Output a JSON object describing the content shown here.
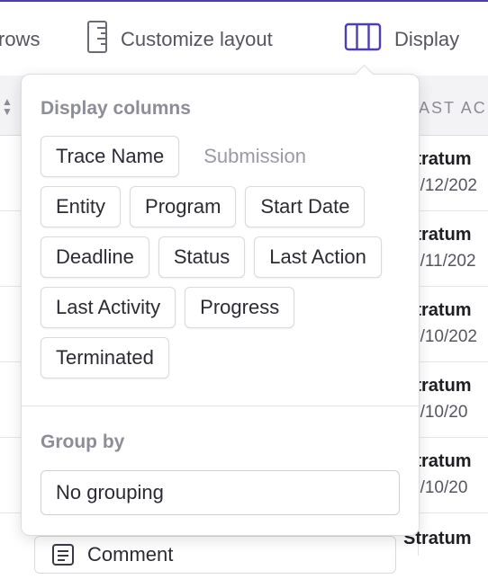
{
  "toolbar": {
    "rows_label": "rows",
    "layout_label": "Customize layout",
    "display_label": "Display"
  },
  "table": {
    "partial_header": "AST AC",
    "rows": [
      {
        "name": "Stratum",
        "date": "0/12/202"
      },
      {
        "name": "Stratum",
        "date": "2/11/202"
      },
      {
        "name": "Stratum",
        "date": "5/10/202"
      },
      {
        "name": "Stratum",
        "date": "4/10/20"
      },
      {
        "name": "Stratum",
        "date": "4/10/20"
      },
      {
        "name": "Stratum",
        "date": ""
      }
    ],
    "comment_label": "Comment"
  },
  "popover": {
    "display_columns_title": "Display columns",
    "columns": [
      {
        "label": "Trace Name",
        "active": true
      },
      {
        "label": "Submission",
        "active": false
      },
      {
        "label": "Entity",
        "active": true
      },
      {
        "label": "Program",
        "active": true
      },
      {
        "label": "Start Date",
        "active": true
      },
      {
        "label": "Deadline",
        "active": true
      },
      {
        "label": "Status",
        "active": true
      },
      {
        "label": "Last Action",
        "active": true
      },
      {
        "label": "Last Activity",
        "active": true
      },
      {
        "label": "Progress",
        "active": true
      },
      {
        "label": "Terminated",
        "active": true
      }
    ],
    "group_by_title": "Group by",
    "group_by_value": "No grouping"
  },
  "colors": {
    "accent": "#4b3fb3",
    "chip_border": "#d9d9de",
    "muted_text": "#8d8d97"
  }
}
